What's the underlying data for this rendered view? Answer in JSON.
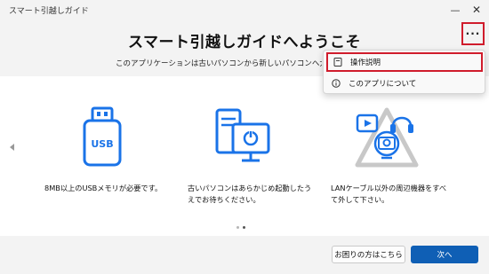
{
  "window": {
    "title": "スマート引越しガイド",
    "minimize_glyph": "—",
    "close_glyph": "✕"
  },
  "header": {
    "heading": "スマート引越しガイドへようこそ",
    "subtitle": "このアプリケーションは古いパソコンから新しいパソコンへ大切なデータ",
    "more_glyph": "···"
  },
  "menu": {
    "items": [
      {
        "label": "操作説明",
        "icon": "document-icon"
      },
      {
        "label": "このアプリについて",
        "icon": "info-icon"
      }
    ]
  },
  "cards": [
    {
      "icon": "usb-memory-icon",
      "icon_text": "USB",
      "text": "8MB以上のUSBメモリが必要です。"
    },
    {
      "icon": "pc-power-icon",
      "text_line1": "古いパソコンはあらかじめ起動したう",
      "text_line2": "えでお待ちください。"
    },
    {
      "icon": "peripherals-icon",
      "text_line1": "LANケーブル以外の周辺機器をすべ",
      "text_line2": "て外して下さい。"
    }
  ],
  "pager": {
    "pages": 2,
    "current": 2
  },
  "footer": {
    "help_label": "お困りの方はこちら",
    "next_label": "次へ"
  },
  "colors": {
    "accent": "#0f5fb5",
    "icon_blue": "#1a73e8",
    "highlight_red": "#d01c2c"
  }
}
